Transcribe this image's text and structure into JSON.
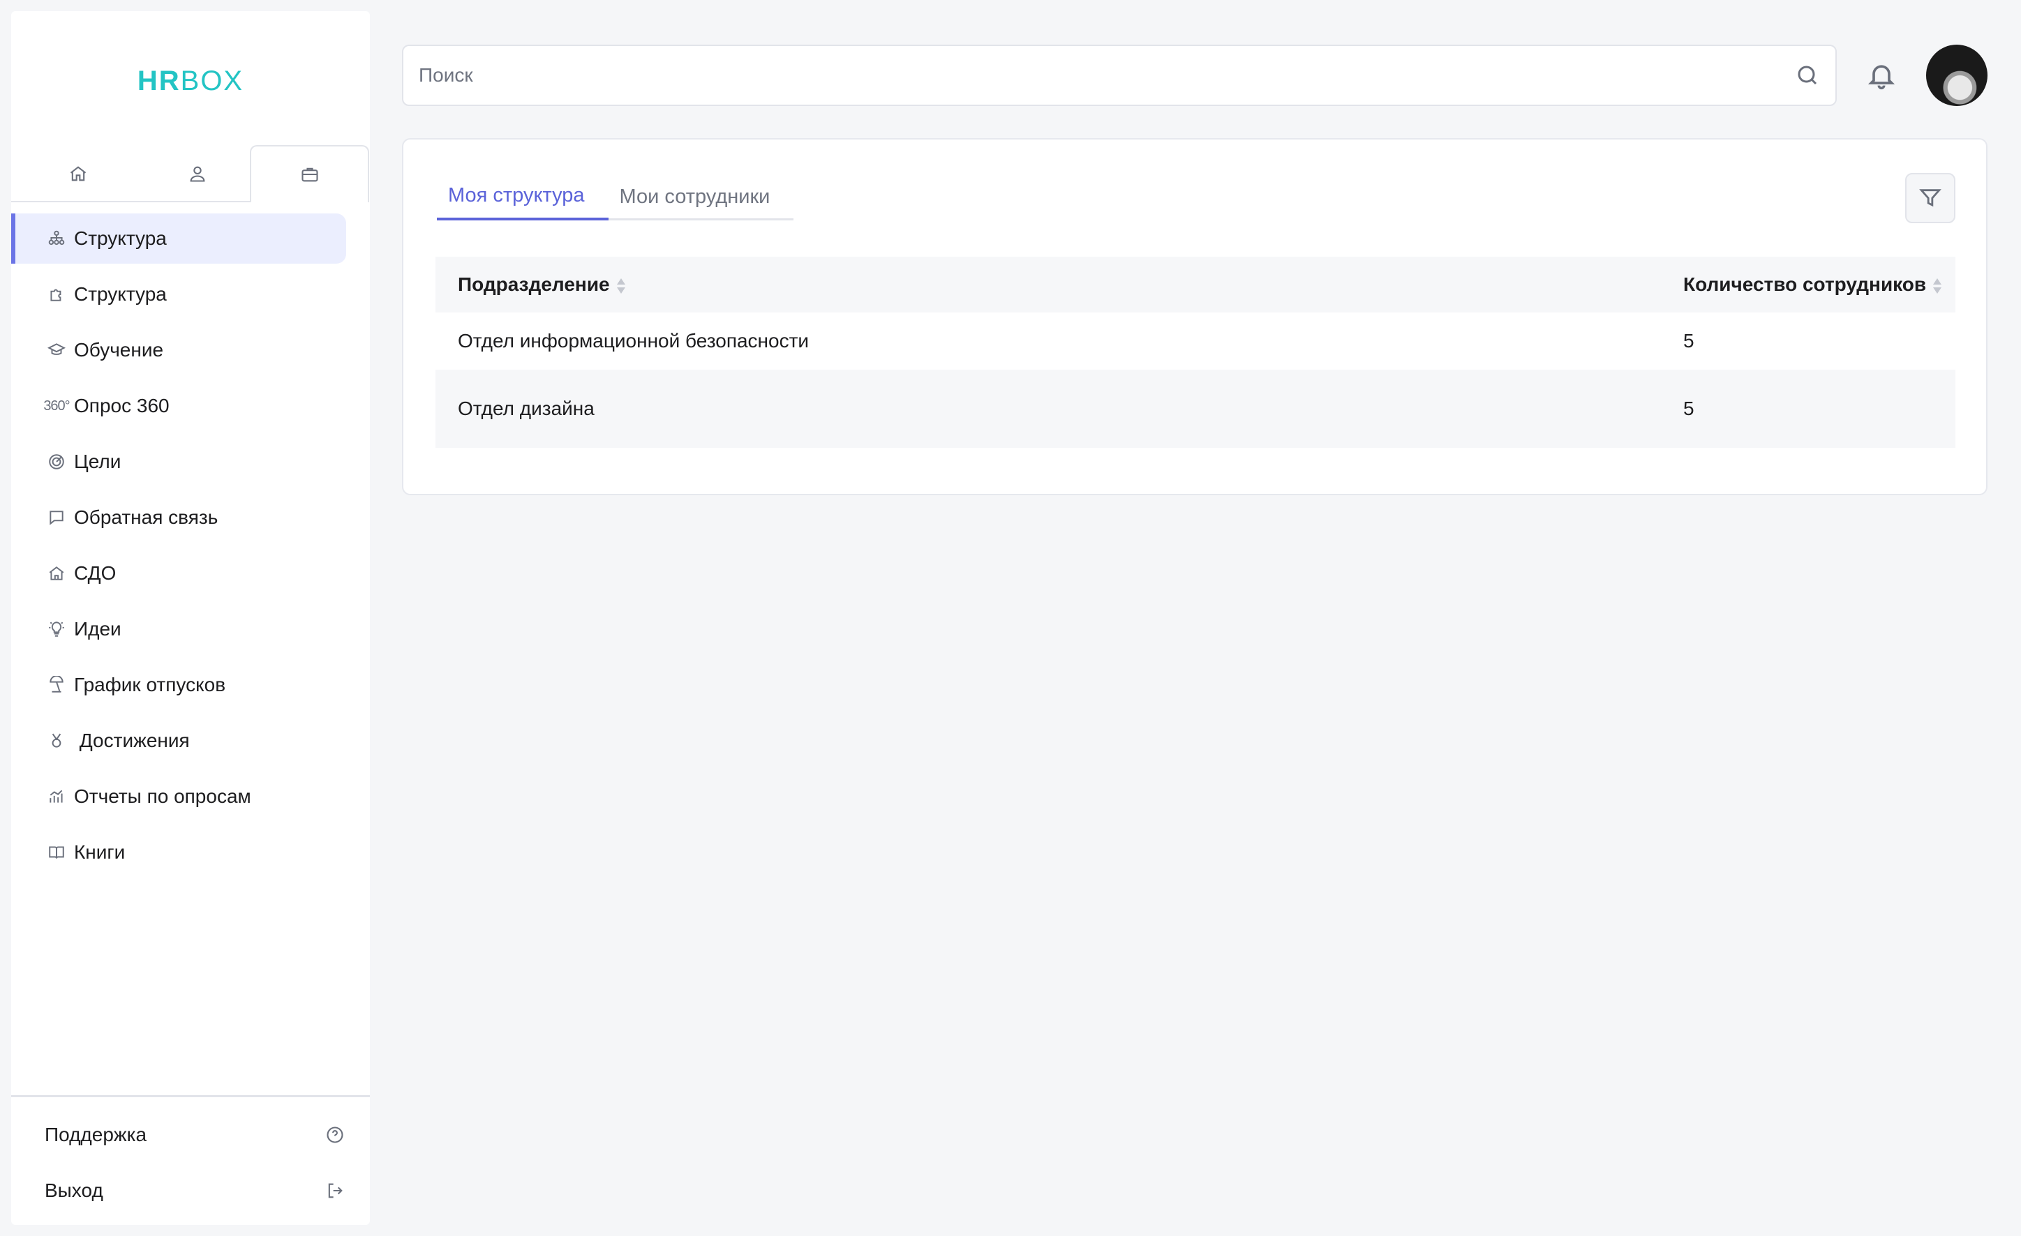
{
  "app": {
    "logo_hr": "HR",
    "logo_box": "BOX"
  },
  "sidebar_tabs": [
    {
      "icon": "home-icon"
    },
    {
      "icon": "user-icon"
    },
    {
      "icon": "briefcase-icon",
      "active": true
    }
  ],
  "nav": {
    "items": [
      {
        "label": "Структура",
        "icon": "org-structure-icon",
        "active": true
      },
      {
        "label": "Структура",
        "icon": "puzzle-icon"
      },
      {
        "label": "Обучение",
        "icon": "graduation-cap-icon"
      },
      {
        "label": "Опрос 360",
        "icon": "360-icon",
        "icon_text": "360°"
      },
      {
        "label": "Цели",
        "icon": "target-icon"
      },
      {
        "label": "Обратная связь",
        "icon": "chat-bubble-icon"
      },
      {
        "label": "СДО",
        "icon": "home-icon"
      },
      {
        "label": "Идеи",
        "icon": "lightbulb-icon"
      },
      {
        "label": "График отпусков",
        "icon": "beach-umbrella-icon"
      },
      {
        "label": " Достижения",
        "icon": "medal-icon"
      },
      {
        "label": "Отчеты по опросам",
        "icon": "chart-icon"
      },
      {
        "label": "Книги",
        "icon": "book-icon"
      }
    ]
  },
  "bottom": {
    "support_label": "Поддержка",
    "logout_label": "Выход"
  },
  "header": {
    "search_placeholder": "Поиск"
  },
  "content": {
    "tabs": [
      {
        "label": "Моя структура",
        "active": true
      },
      {
        "label": "Мои сотрудники"
      }
    ],
    "table": {
      "columns": [
        "Подразделение",
        "Количество сотрудников"
      ],
      "rows": [
        [
          "Отдел информационной безопасности",
          "5"
        ],
        [
          "Отдел дизайна",
          "5"
        ]
      ]
    }
  },
  "colors": {
    "brand": "#23c4c4",
    "accent": "#5b63d9",
    "active_nav_bg": "#ebeefe",
    "background": "#f5f6f8"
  }
}
